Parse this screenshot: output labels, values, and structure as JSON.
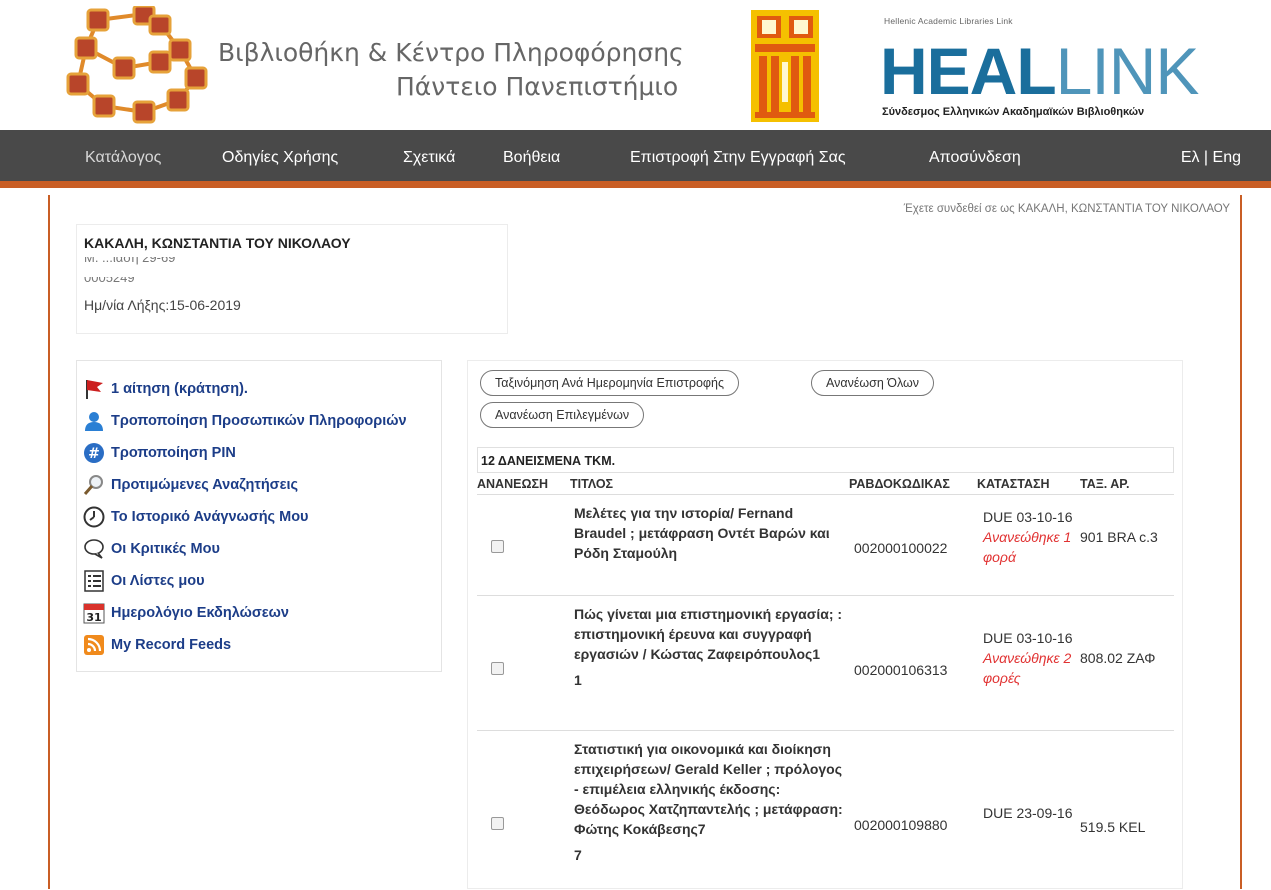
{
  "header": {
    "title_line1": "Βιβλιοθήκη & Κέντρο Πληροφόρησης",
    "title_line2": "Πάντειο Πανεπιστήμιο",
    "heallink_small": "Hellenic Academic Libraries Link",
    "heallink_strong": "HEAL",
    "heallink_light": "LINK",
    "heallink_sub": "Σύνδεσμος Ελληνικών Ακαδημαϊκών Βιβλιοθηκών"
  },
  "nav": {
    "items": [
      "Κατάλογος",
      "Οδηγίες Χρήσης",
      "Σχετικά",
      "Βοήθεια",
      "Επιστροφή Στην Εγγραφή Σας",
      "Αποσύνδεση"
    ],
    "lang": "Ελ | Eng"
  },
  "logged_in_text": "Έχετε συνδεθεί σε ως ΚΑΚΑΛΗ, ΚΩΝΣΤΑΝΤΙΑ ΤΟΥ ΝΙΚΟΛΑΟΥ",
  "patron": {
    "name": "ΚΑΚΑΛΗ, ΚΩΝΣΤΑΝΤΙΑ ΤΟΥ ΝΙΚΟΛΑΟΥ",
    "line2": "Μ. ...ιάση 29-69",
    "line3": "0005249",
    "expiry": "Ημ/νία Λήξης:15-06-2019"
  },
  "side_menu": [
    {
      "icon": "red-flag-icon",
      "label": "1 αίτηση (κράτηση)."
    },
    {
      "icon": "user-icon",
      "label": "Τροποποίηση Προσωπικών Πληροφοριών"
    },
    {
      "icon": "hash-icon",
      "label": "Τροποποίηση PIN"
    },
    {
      "icon": "magnifier-icon",
      "label": "Προτιμώμενες Αναζητήσεις"
    },
    {
      "icon": "clock-icon",
      "label": "Το Ιστορικό Ανάγνωσής Μου"
    },
    {
      "icon": "speech-bubble-icon",
      "label": "Οι Κριτικές Μου"
    },
    {
      "icon": "list-icon",
      "label": "Οι Λίστες μου"
    },
    {
      "icon": "calendar-icon",
      "label": "Ημερολόγιο Εκδηλώσεων",
      "icon_text": "31"
    },
    {
      "icon": "rss-icon",
      "label": "My Record Feeds"
    }
  ],
  "loans": {
    "btn_sort": "Ταξινόμηση Ανά Ημερομηνία Επιστροφής",
    "btn_renew_all": "Ανανέωση Όλων",
    "btn_renew_selected": "Ανανέωση Επιλεγμένων",
    "section_title": "12 ΔΑΝΕΙΣΜΕΝΑ ΤΚΜ.",
    "columns": [
      "ΑΝΑΝΕΩΣΗ",
      "ΤΙΤΛΟΣ",
      "ΡΑΒΔΟΚΩΔΙΚΑΣ",
      "ΚΑΤΑΣΤΑΣΗ",
      "ΤΑΞ. ΑΡ."
    ],
    "rows": [
      {
        "title": "Μελέτες για την ιστορία/ Fernand Braudel ; μετάφραση Οντέτ Βαρών και Ρόδη Σταμούλη",
        "barcode": "002000100022",
        "due": "DUE 03-10-16",
        "renewed": "Ανανεώθηκε 1 φορά",
        "call": "901 BRA c.3"
      },
      {
        "title": "Πώς γίνεται μια επιστημονική εργασία; : επιστημονική έρευνα και συγγραφή εργασιών / Κώστας Ζαφειρόπουλος1",
        "title_extra": "1",
        "barcode": "002000106313",
        "due": "DUE 03-10-16",
        "renewed": "Ανανεώθηκε 2 φορές",
        "call": "808.02 ΖΑΦ"
      },
      {
        "title": "Στατιστική για οικονομικά και διοίκηση επιχειρήσεων/ Gerald Keller ; πρόλογος - επιμέλεια ελληνικής έκδοσης: Θεόδωρος Χατζηπαντελής ; μετάφραση: Φώτης Κοκάβεσης7",
        "title_extra": "7",
        "barcode": "002000109880",
        "due": "DUE 23-09-16",
        "renewed": "",
        "call": "519.5 KEL"
      }
    ]
  },
  "colors": {
    "nav_bg": "#494949",
    "accent": "#c95e25",
    "link_blue": "#1c3d88",
    "renew_red": "#e13232",
    "heal_blue": "#1a6e9c"
  }
}
